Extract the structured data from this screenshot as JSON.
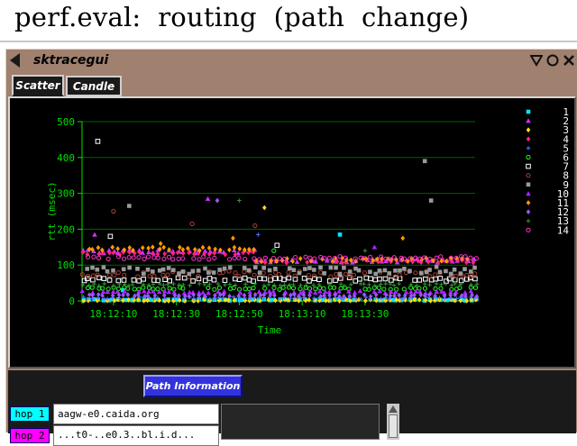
{
  "slide": {
    "title": "perf.eval:  routing  (path  change)"
  },
  "window": {
    "title": "sktracegui",
    "controls": [
      "menu-triangle-icon",
      "minimize-circle-icon",
      "close-x-icon"
    ]
  },
  "tabs": [
    {
      "label": "Scatter",
      "active": true
    },
    {
      "label": "Candle",
      "active": false
    }
  ],
  "path_info": {
    "button_label": "Path Information"
  },
  "hops": [
    {
      "label": "hop 1",
      "color": "#00ffff",
      "host": "aagw-e0.caida.org"
    },
    {
      "label": "hop 2",
      "color": "#ff00ff",
      "host": "...t0-..e0.3..bl.i.d..."
    }
  ],
  "colors": {
    "plot_bg": "#000000",
    "axis": "#00e000",
    "grid": "#006000",
    "window": "#a0806e"
  },
  "chart_data": {
    "type": "scatter",
    "title": "",
    "xlabel": "Time",
    "ylabel": "rtt (msec)",
    "ylim": [
      0,
      500
    ],
    "yticks": [
      "0",
      "100",
      "200",
      "300",
      "400",
      "500"
    ],
    "xlim": [
      "18:12:00",
      "18:14:05"
    ],
    "xticks": [
      "18:12:10",
      "18:12:30",
      "18:12:50",
      "18:13:10",
      "18:13:30"
    ],
    "grid": true,
    "legend_placement": "right",
    "series": [
      {
        "name": "1",
        "color": "#00e5ff",
        "marker": "square",
        "bands": [
          {
            "from": "18:12:00",
            "to": "18:14:05",
            "center": 3,
            "spread": 2
          }
        ],
        "outliers": [
          [
            "18:12:13",
            30
          ],
          [
            "18:13:22",
            185
          ]
        ]
      },
      {
        "name": "2",
        "color": "#cc33ff",
        "marker": "triangle",
        "bands": [
          {
            "from": "18:12:00",
            "to": "18:12:55",
            "center": 138,
            "spread": 5
          },
          {
            "from": "18:12:55",
            "to": "18:14:05",
            "center": 112,
            "spread": 5
          }
        ],
        "outliers": [
          [
            "18:12:04",
            185
          ],
          [
            "18:12:40",
            285
          ]
        ]
      },
      {
        "name": "3",
        "color": "#ffe000",
        "marker": "diamond",
        "bands": [
          {
            "from": "18:12:00",
            "to": "18:14:05",
            "center": 2,
            "spread": 2
          }
        ],
        "outliers": [
          [
            "18:12:58",
            260
          ]
        ]
      },
      {
        "name": "4",
        "color": "#ff2277",
        "marker": "diamond",
        "bands": [
          {
            "from": "18:12:00",
            "to": "18:12:55",
            "center": 133,
            "spread": 4
          },
          {
            "from": "18:12:55",
            "to": "18:14:05",
            "center": 110,
            "spread": 4
          }
        ],
        "outliers": []
      },
      {
        "name": "5",
        "color": "#5577ff",
        "marker": "plus",
        "bands": [
          {
            "from": "18:12:00",
            "to": "18:14:05",
            "center": 8,
            "spread": 3
          }
        ],
        "outliers": [
          [
            "18:12:56",
            185
          ]
        ]
      },
      {
        "name": "6",
        "color": "#22ff22",
        "marker": "circle",
        "bands": [
          {
            "from": "18:12:00",
            "to": "18:14:05",
            "center": 35,
            "spread": 3
          }
        ],
        "outliers": [
          [
            "18:13:01",
            140
          ]
        ]
      },
      {
        "name": "7",
        "color": "#ffffff",
        "marker": "open-square",
        "bands": [
          {
            "from": "18:12:00",
            "to": "18:14:05",
            "center": 60,
            "spread": 5
          }
        ],
        "outliers": [
          [
            "18:12:05",
            445
          ],
          [
            "18:12:09",
            180
          ],
          [
            "18:13:02",
            155
          ]
        ]
      },
      {
        "name": "8",
        "color": "#aa4433",
        "marker": "circle",
        "bands": [
          {
            "from": "18:12:00",
            "to": "18:14:05",
            "center": 75,
            "spread": 8
          }
        ],
        "outliers": [
          [
            "18:12:10",
            250
          ],
          [
            "18:12:55",
            210
          ],
          [
            "18:12:35",
            215
          ]
        ]
      },
      {
        "name": "9",
        "color": "#999999",
        "marker": "square",
        "bands": [
          {
            "from": "18:12:00",
            "to": "18:14:05",
            "center": 85,
            "spread": 10
          }
        ],
        "outliers": [
          [
            "18:12:15",
            265
          ],
          [
            "18:13:49",
            390
          ],
          [
            "18:13:51",
            280
          ]
        ]
      },
      {
        "name": "10",
        "color": "#aa22ff",
        "marker": "triangle",
        "bands": [
          {
            "from": "18:12:00",
            "to": "18:14:05",
            "center": 25,
            "spread": 3
          }
        ],
        "outliers": [
          [
            "18:13:33",
            150
          ]
        ]
      },
      {
        "name": "11",
        "color": "#ff9900",
        "marker": "diamond",
        "bands": [
          {
            "from": "18:12:00",
            "to": "18:12:55",
            "center": 145,
            "spread": 5
          },
          {
            "from": "18:12:55",
            "to": "18:14:05",
            "center": 115,
            "spread": 5
          }
        ],
        "outliers": [
          [
            "18:12:25",
            160
          ],
          [
            "18:12:48",
            175
          ],
          [
            "18:13:42",
            175
          ]
        ]
      },
      {
        "name": "12",
        "color": "#9955ff",
        "marker": "diamond",
        "bands": [
          {
            "from": "18:12:00",
            "to": "18:14:05",
            "center": 15,
            "spread": 3
          }
        ],
        "outliers": [
          [
            "18:12:43",
            280
          ]
        ]
      },
      {
        "name": "13",
        "color": "#339933",
        "marker": "plus",
        "bands": [
          {
            "from": "18:12:00",
            "to": "18:14:05",
            "center": 45,
            "spread": 3
          }
        ],
        "outliers": [
          [
            "18:12:50",
            280
          ],
          [
            "18:13:30",
            140
          ]
        ]
      },
      {
        "name": "14",
        "color": "#ff33cc",
        "marker": "circle",
        "bands": [
          {
            "from": "18:12:00",
            "to": "18:14:05",
            "center": 120,
            "spread": 4
          }
        ],
        "outliers": []
      }
    ]
  }
}
